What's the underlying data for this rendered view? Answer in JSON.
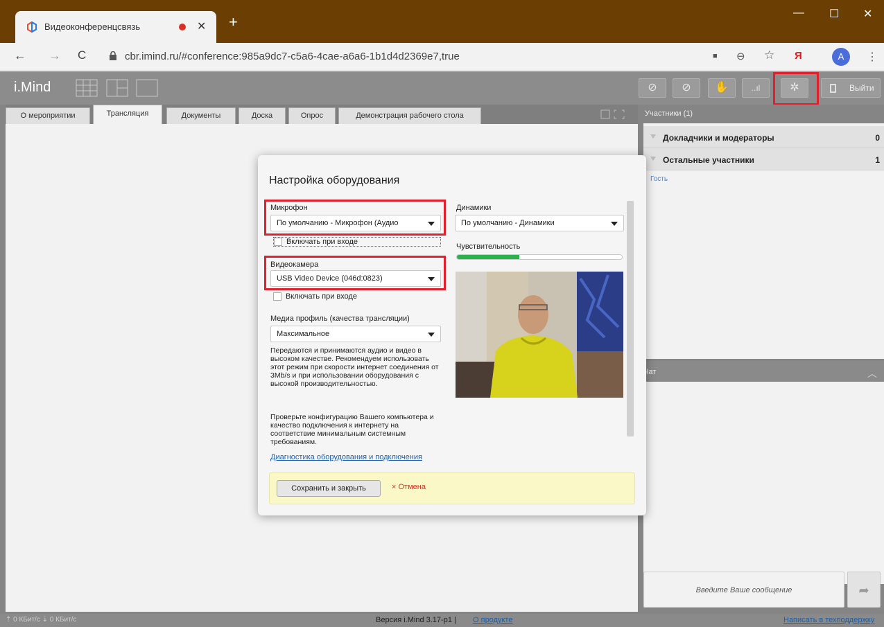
{
  "browser": {
    "tab_title": "Видеоконференцсвязь",
    "tab_close": "✕",
    "new_tab": "+",
    "url": "cbr.imind.ru/#conference:985a9dc7-c5a6-4cae-a6a6-1b1d4d2369e7,true",
    "avatar_letter": "A",
    "window_controls": {
      "minimize": "—",
      "maximize": "☐",
      "close": "✕"
    },
    "nav": {
      "back": "←",
      "forward": "→",
      "reload": "C"
    },
    "icons": {
      "camera": "■",
      "zoom": "⊖",
      "star": "☆",
      "yandex": "Я",
      "menu": "⋮"
    }
  },
  "app": {
    "logo": "i.Mind",
    "exit_label": "Выйти",
    "header_buttons": {
      "video": "⊘",
      "mic": "⊘",
      "hand": "✋",
      "signal": "..ıl",
      "settings": "✲"
    }
  },
  "tabs": [
    {
      "label": "О мероприятии"
    },
    {
      "label": "Трансляция",
      "active": true
    },
    {
      "label": "Документы"
    },
    {
      "label": "Доска"
    },
    {
      "label": "Опрос"
    },
    {
      "label": "Демонстрация рабочего стола"
    }
  ],
  "participants": {
    "header": "Участники (1)",
    "groups": [
      {
        "name": "Докладчики и модераторы",
        "count": "0"
      },
      {
        "name": "Остальные участники",
        "count": "1"
      }
    ],
    "guest": "Гость"
  },
  "chat": {
    "header": "Чат",
    "placeholder": "Введите Ваше сообщение",
    "send_icon": "➦",
    "collapse_icon": "︿"
  },
  "modal": {
    "title": "Настройка оборудования",
    "microphone_label": "Микрофон",
    "microphone_value": "По умолчанию - Микрофон (Аудио",
    "mic_autoenable": "Включать при входе",
    "camera_label": "Видеокамера",
    "camera_value": "USB Video Device (046d:0823)",
    "camera_autoenable": "Включать при входе",
    "profile_label": "Медиа профиль (качества трансляции)",
    "profile_value": "Максимальное",
    "profile_desc": "Передаются и принимаются аудио и видео в высоком качестве. Рекомендуем использовать этот режим при скорости интернет соединения от 3Mb/s и при использовании оборудования с высокой производительностью.",
    "config_desc": "Проверьте конфигурацию Вашего компьютера и качество подключения к интернету на соответствие минимальным системным требованиям.",
    "diag_link": "Диагностика оборудования и подключения",
    "speakers_label": "Динамики",
    "speakers_value": "По умолчанию - Динамики",
    "sensitivity_label": "Чувствительность",
    "sensitivity_level": 0.38,
    "save_label": "Сохранить и закрыть",
    "cancel_label": "× Отмена"
  },
  "status": {
    "traffic": "⇡ 0 КБит/с  ⇣ 0 КБит/с",
    "version": "Версия i.Mind 3.17-p1  |",
    "about": "О продукте",
    "support": "Написать в техподдержку"
  },
  "colors": {
    "highlight": "#e0202d",
    "meter": "#2bb24c",
    "link": "#1d5fa8",
    "title_bar": "#6b3f03"
  }
}
